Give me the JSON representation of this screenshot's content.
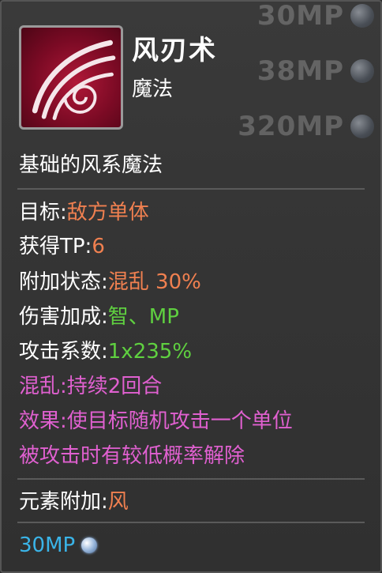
{
  "background_costs": [
    "30MP",
    "38MP",
    "320MP"
  ],
  "skill": {
    "name": "风刃术",
    "type": "魔法",
    "description": "基础的风系魔法",
    "icon": "wind-blade-icon"
  },
  "stats": {
    "target_label": "目标:",
    "target_value": "敌方单体",
    "tp_label": "获得TP:",
    "tp_value": "6",
    "status_label": "附加状态:",
    "status_value": "混乱 30%",
    "bonus_label": "伤害加成:",
    "bonus_value": "智、MP",
    "coef_label": "攻击系数:",
    "coef_value": "1x235%",
    "confuse_line": "混乱:持续2回合",
    "effect_line1": "效果:使目标随机攻击一个单位",
    "effect_line2": "被攻击时有较低概率解除",
    "element_label": "元素附加:",
    "element_value": "风"
  },
  "cost": "30MP",
  "colors": {
    "orange": "#f08050",
    "green": "#5fd040",
    "magenta": "#e060d0",
    "cyan": "#3ab4e8"
  }
}
